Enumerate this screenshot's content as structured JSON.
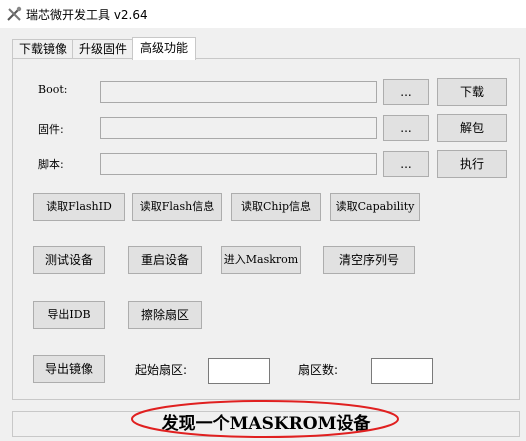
{
  "window": {
    "title": "瑞芯微开发工具 v2.64"
  },
  "tabs": [
    {
      "label": "下载镜像"
    },
    {
      "label": "升级固件"
    },
    {
      "label": "高级功能"
    }
  ],
  "rows": {
    "boot": {
      "label": "Boot:",
      "browse": "...",
      "action": "下载"
    },
    "firmware": {
      "label": "固件:",
      "browse": "...",
      "action": "解包"
    },
    "script": {
      "label": "脚本:",
      "browse": "...",
      "action": "执行"
    }
  },
  "buttons": {
    "read_flash_id": "读取FlashID",
    "read_flash_info": "读取Flash信息",
    "read_chip_info": "读取Chip信息",
    "read_capability": "读取Capability",
    "test_device": "测试设备",
    "reboot_device": "重启设备",
    "enter_maskrom": "进入Maskrom",
    "clear_serial": "清空序列号",
    "export_idb": "导出IDB",
    "erase_sector": "擦除扇区",
    "export_image": "导出镜像"
  },
  "export": {
    "start_sector_label": "起始扇区:",
    "sector_count_label": "扇区数:",
    "start_sector_value": "",
    "sector_count_value": ""
  },
  "status": {
    "text": "发现一个MASKROM设备"
  },
  "colors": {
    "annotation_ellipse": "#e02020"
  }
}
